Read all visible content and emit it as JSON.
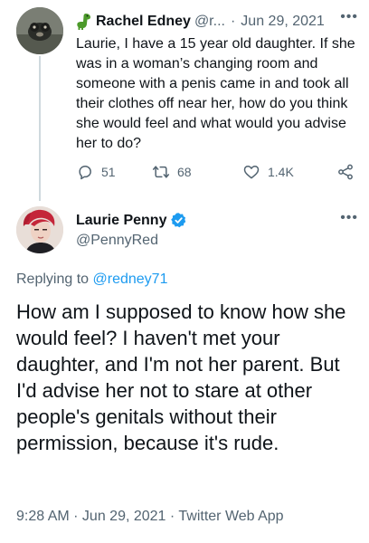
{
  "parent_tweet": {
    "display_name": "Rachel Edney",
    "handle": "@r...",
    "separator": "·",
    "date": "Jun 29, 2021",
    "more": "•••",
    "text": "Laurie, I have a 15 year old daughter. If she was in a woman’s changing room and someone with a penis came in  and took all their clothes off near her, how do you think she would feel and what would you advise her to do?",
    "stats": {
      "replies": "51",
      "retweets": "68",
      "likes": "1.4K"
    },
    "icons": [
      "dinosaur-emoji",
      "reply-icon",
      "retweet-icon",
      "like-icon",
      "share-icon"
    ]
  },
  "main_tweet": {
    "display_name": "Laurie Penny",
    "handle": "@PennyRed",
    "more": "•••",
    "replying_prefix": "Replying to ",
    "replying_handle": "@redney71",
    "text": "How am I supposed to know how she would feel? I haven't met your daughter, and I'm not her parent. But I'd advise her not to stare at other people's genitals without their permission, because it's rude.",
    "timestamp": "9:28 AM · Jun 29, 2021 · Twitter Web App",
    "icons": [
      "verified-badge-icon"
    ]
  },
  "colors": {
    "text": "#0f1419",
    "secondary": "#536471",
    "accent": "#1d9bf0",
    "thread_line": "#cfd9de"
  }
}
